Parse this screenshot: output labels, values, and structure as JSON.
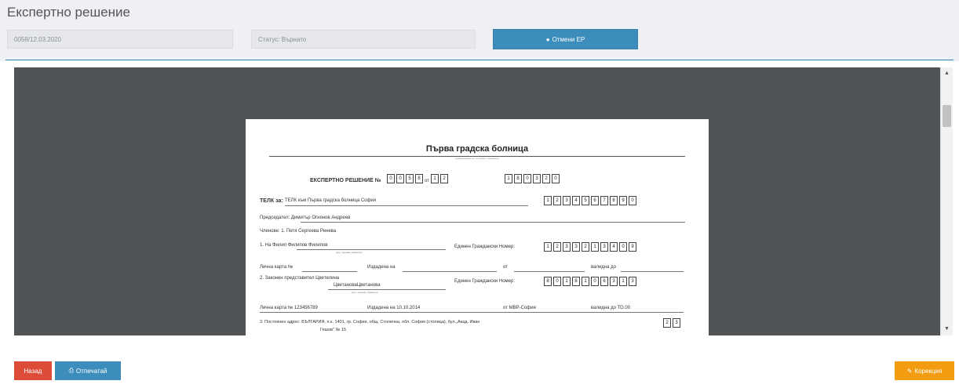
{
  "header": {
    "title": "Експертно решение",
    "field_number": "0058/12.03.2020",
    "field_status": "Статус: Върнато",
    "cancel_button": "Отмени ЕР"
  },
  "document": {
    "hospital": "Първа градска болница",
    "hospital_caption": "наименование на лечебното заведение",
    "decision_label": "ЕКСПЕРТНО РЕШЕНИЕ №",
    "decision_number_digits": [
      "0",
      "0",
      "5",
      "8"
    ],
    "decision_from": "от",
    "decision_day_digits": [
      "1",
      "2"
    ],
    "decision_date_digits": [
      "1",
      "8",
      "0",
      "3",
      "2",
      "0"
    ],
    "telk_label": "ТЕЛК за:",
    "telk_value": "ТЕЛК към Първа градска болница София",
    "telk_digits": [
      "1",
      "2",
      "3",
      "4",
      "5",
      "6",
      "7",
      "8",
      "9",
      "0"
    ],
    "chairman": "Председател:  Димитър Огнянов Андреев",
    "members": "Членове:      1. Петя Сергеева Ренева",
    "person_line": "1. На Филип Филипов Филипов",
    "person_caption": "име, презиме, фамилия",
    "egn_label": "Единен Граждански Номер:",
    "person_egn_digits": [
      "1",
      "2",
      "3",
      "3",
      "2",
      "1",
      "3",
      "4",
      "0",
      "9"
    ],
    "id_card_label": "Лична карта №",
    "issued_on": "Издадена на",
    "issued_from": "от",
    "valid_to": "валидна до",
    "rep_line": "2. Законен представител Цветелина",
    "rep_line2": "ЦветановаЦветанова",
    "rep_caption": "име, презиме, фамилия",
    "rep_egn_digits": [
      "8",
      "0",
      "1",
      "8",
      "1",
      "0",
      "6",
      "3",
      "1",
      "3"
    ],
    "rep_card": "Лична карта № 123456789",
    "rep_issued": "Издадена на 10.10.2014",
    "rep_from": "от МВР-София",
    "rep_valid": "валидна до ТО.00",
    "address_line": "3. Постоянен адрес: БЪЛГАРИЯ, п.к. 1401, гр. София, общ. Столична, обл. София (столица), бул.„Акад. Иван",
    "address_line2": "Гешов\" № 15",
    "address_digits": [
      "2",
      "3"
    ]
  },
  "footer": {
    "back_button": "Назад",
    "print_button": "Отпечатай",
    "correction_button": "Корекция"
  },
  "colors": {
    "primary": "#3c8dbc",
    "danger": "#dd4b39",
    "warning": "#f39c12",
    "viewer_bg": "#515456"
  },
  "icons": {
    "cancel": "circle-icon",
    "print": "print-icon",
    "correction": "edit-icon"
  }
}
